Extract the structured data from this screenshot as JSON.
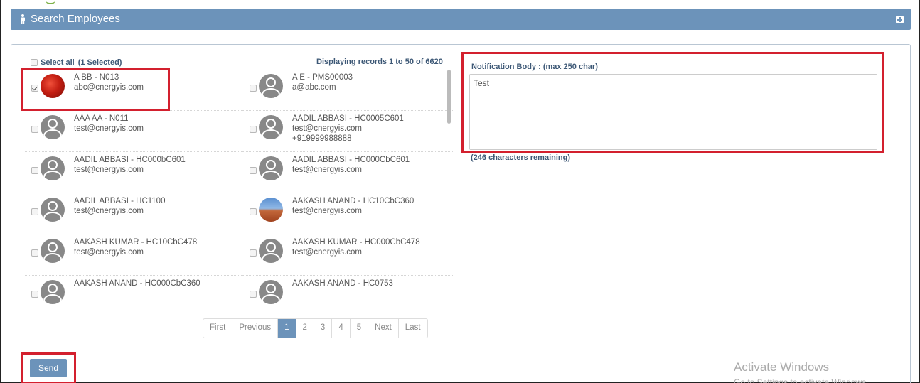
{
  "panel": {
    "title": "Search Employees"
  },
  "list": {
    "select_all_label": "Select all",
    "selected_count": "(1 Selected)",
    "records_text": "Displaying records 1 to 50 of 6620",
    "employees": [
      {
        "name": "A BB - N013",
        "email": "abc@cnergyis.com",
        "phone": "",
        "checked": true,
        "avatar": "photo-red"
      },
      {
        "name": "A E - PMS00003",
        "email": "a@abc.com",
        "phone": "",
        "checked": false,
        "avatar": "default"
      },
      {
        "name": "AAA AA - N011",
        "email": "test@cnergyis.com",
        "phone": "",
        "checked": false,
        "avatar": "default"
      },
      {
        "name": "AADIL ABBASI - HC0005C601",
        "email": "test@cnergyis.com",
        "phone": "+919999988888",
        "checked": false,
        "avatar": "default"
      },
      {
        "name": "AADIL ABBASI - HC000bC601",
        "email": "test@cnergyis.com",
        "phone": "",
        "checked": false,
        "avatar": "default"
      },
      {
        "name": "AADIL ABBASI - HC000CbC601",
        "email": "test@cnergyis.com",
        "phone": "",
        "checked": false,
        "avatar": "default"
      },
      {
        "name": "AADIL ABBASI - HC1100",
        "email": "test@cnergyis.com",
        "phone": "",
        "checked": false,
        "avatar": "default"
      },
      {
        "name": "AAKASH ANAND - HC10CbC360",
        "email": "test@cnergyis.com",
        "phone": "",
        "checked": false,
        "avatar": "photo-desert"
      },
      {
        "name": "AAKASH KUMAR - HC10CbC478",
        "email": "test@cnergyis.com",
        "phone": "",
        "checked": false,
        "avatar": "default"
      },
      {
        "name": "AAKASH KUMAR - HC000CbC478",
        "email": "test@cnergyis.com",
        "phone": "",
        "checked": false,
        "avatar": "default"
      },
      {
        "name": "AAKASH ANAND - HC000CbC360",
        "email": "",
        "phone": "",
        "checked": false,
        "avatar": "default"
      },
      {
        "name": "AAKASH ANAND - HC0753",
        "email": "",
        "phone": "",
        "checked": false,
        "avatar": "default"
      }
    ]
  },
  "pagination": {
    "first": "First",
    "previous": "Previous",
    "pages": [
      "1",
      "2",
      "3",
      "4",
      "5"
    ],
    "current_page": "1",
    "next": "Next",
    "last": "Last"
  },
  "notification": {
    "label": "Notification Body : (max 250 char)",
    "value": "Test",
    "remaining": "(246 characters remaining)"
  },
  "send_label": "Send",
  "watermark": {
    "line1": "Activate Windows",
    "line2": "Go to Settings to activate Windows."
  },
  "colors": {
    "header_bg": "#6c93ba",
    "label_text": "#3d5876",
    "highlight_box": "#d3202e"
  }
}
